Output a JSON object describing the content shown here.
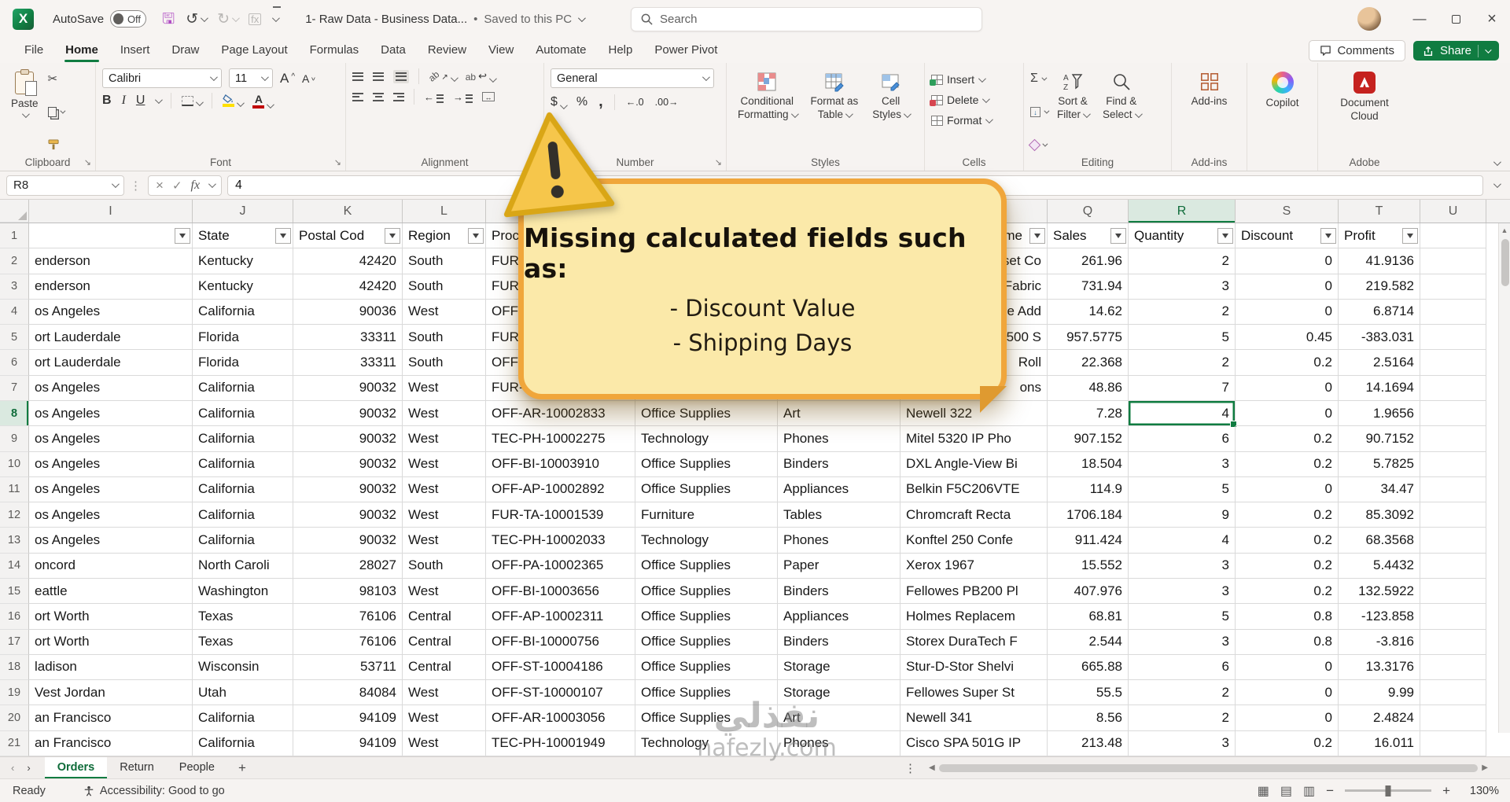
{
  "colors": {
    "accent_green": "#107C41",
    "callout_fill": "#FBE9A9",
    "callout_border": "#F0A63B",
    "share_green": "#107C41"
  },
  "titlebar": {
    "autosave_label": "AutoSave",
    "autosave_state": "Off",
    "doc_title": "1- Raw Data - Business Data...",
    "separator": "•",
    "doc_status": "Saved to this PC",
    "search_placeholder": "Search"
  },
  "ribbon": {
    "tabs": [
      "File",
      "Home",
      "Insert",
      "Draw",
      "Page Layout",
      "Formulas",
      "Data",
      "Review",
      "View",
      "Automate",
      "Help",
      "Power Pivot"
    ],
    "active_tab": "Home",
    "comments_label": "Comments",
    "share_label": "Share",
    "clipboard": {
      "paste": "Paste",
      "group": "Clipboard"
    },
    "font": {
      "name": "Calibri",
      "size": "11",
      "bold": "B",
      "italic": "I",
      "underline": "U",
      "grow": "A",
      "shrink": "A",
      "color_a": "A",
      "group": "Font"
    },
    "alignment": {
      "orient": "ab",
      "wrap": "ab",
      "group": "Alignment"
    },
    "number": {
      "format": "General",
      "currency": "$",
      "percent": "%",
      "comma": ",",
      "dec_inc": "←.0",
      "dec_dec": ".00→",
      "group": "Number"
    },
    "styles": {
      "cond1": "Conditional",
      "cond2": "Formatting",
      "fmt1": "Format as",
      "fmt2": "Table",
      "cs1": "Cell",
      "cs2": "Styles",
      "group": "Styles"
    },
    "cells": {
      "insert": "Insert",
      "delete": "Delete",
      "format": "Format",
      "group": "Cells"
    },
    "editing": {
      "sum": "Σ",
      "sort1": "Sort &",
      "sort2": "Filter",
      "find1": "Find &",
      "find2": "Select",
      "group": "Editing"
    },
    "addins": {
      "label": "Add-ins",
      "group": "Add-ins"
    },
    "copilot": {
      "label": "Copilot"
    },
    "adobe": {
      "label1": "Document",
      "label2": "Cloud",
      "group": "Adobe"
    }
  },
  "formula": {
    "name_box": "R8",
    "cancel": "×",
    "ok": "✓",
    "fx": "fx",
    "value": "4"
  },
  "callout": {
    "heading": "Missing calculated fields such as:",
    "items": [
      "- Discount Value",
      "- Shipping Days"
    ]
  },
  "grid": {
    "col_letters": [
      "I",
      "J",
      "K",
      "L",
      "M",
      "N",
      "O",
      "P",
      "Q",
      "R",
      "S",
      "T",
      "U"
    ],
    "selected_col": "R",
    "active_row": 8,
    "active_col": "r",
    "headers": {
      "I": "",
      "J": "State",
      "K": "Postal Cod",
      "L": "Region",
      "M": "Proc",
      "N": "",
      "O": "",
      "P": "me",
      "Q": "Sales",
      "R": "Quantity",
      "S": "Discount",
      "T": "Profit",
      "U": ""
    },
    "filter_cols": [
      "I",
      "J",
      "K",
      "L",
      "P",
      "Q",
      "R",
      "S",
      "T"
    ],
    "rows": [
      {
        "num": 2,
        "i": "enderson",
        "j": "Kentucky",
        "k": "42420",
        "l": "South",
        "m": "FUR-",
        "n": "",
        "o": "",
        "p": "set Co",
        "q": "261.96",
        "r": "2",
        "s": "0",
        "t": "41.9136"
      },
      {
        "num": 3,
        "i": "enderson",
        "j": "Kentucky",
        "k": "42420",
        "l": "South",
        "m": "FUR-",
        "n": "",
        "o": "",
        "p": "Fabric",
        "q": "731.94",
        "r": "3",
        "s": "0",
        "t": "219.582"
      },
      {
        "num": 4,
        "i": "os Angeles",
        "j": "California",
        "k": "90036",
        "l": "West",
        "m": "OFF-",
        "n": "",
        "o": "",
        "p": "e Add",
        "q": "14.62",
        "r": "2",
        "s": "0",
        "t": "6.8714"
      },
      {
        "num": 5,
        "i": "ort Lauderdale",
        "j": "Florida",
        "k": "33311",
        "l": "South",
        "m": "FUR-",
        "n": "",
        "o": "",
        "p": "500 S",
        "q": "957.5775",
        "r": "5",
        "s": "0.45",
        "t": "-383.031"
      },
      {
        "num": 6,
        "i": "ort Lauderdale",
        "j": "Florida",
        "k": "33311",
        "l": "South",
        "m": "OFF-",
        "n": "",
        "o": "",
        "p": "Roll",
        "q": "22.368",
        "r": "2",
        "s": "0.2",
        "t": "2.5164"
      },
      {
        "num": 7,
        "i": "os Angeles",
        "j": "California",
        "k": "90032",
        "l": "West",
        "m": "FUR-Fu",
        "n": "",
        "o": "",
        "p": "ons",
        "q": "48.86",
        "r": "7",
        "s": "0",
        "t": "14.1694"
      },
      {
        "num": 8,
        "i": "os Angeles",
        "j": "California",
        "k": "90032",
        "l": "West",
        "m": "OFF-AR-10002833",
        "n": "Office Supplies",
        "o": "Art",
        "p": "Newell 322",
        "q": "7.28",
        "r": "4",
        "s": "0",
        "t": "1.9656"
      },
      {
        "num": 9,
        "i": "os Angeles",
        "j": "California",
        "k": "90032",
        "l": "West",
        "m": "TEC-PH-10002275",
        "n": "Technology",
        "o": "Phones",
        "p": "Mitel 5320 IP Pho",
        "q": "907.152",
        "r": "6",
        "s": "0.2",
        "t": "90.7152"
      },
      {
        "num": 10,
        "i": "os Angeles",
        "j": "California",
        "k": "90032",
        "l": "West",
        "m": "OFF-BI-10003910",
        "n": "Office Supplies",
        "o": "Binders",
        "p": "DXL Angle-View Bi",
        "q": "18.504",
        "r": "3",
        "s": "0.2",
        "t": "5.7825"
      },
      {
        "num": 11,
        "i": "os Angeles",
        "j": "California",
        "k": "90032",
        "l": "West",
        "m": "OFF-AP-10002892",
        "n": "Office Supplies",
        "o": "Appliances",
        "p": "Belkin F5C206VTE",
        "q": "114.9",
        "r": "5",
        "s": "0",
        "t": "34.47"
      },
      {
        "num": 12,
        "i": "os Angeles",
        "j": "California",
        "k": "90032",
        "l": "West",
        "m": "FUR-TA-10001539",
        "n": "Furniture",
        "o": "Tables",
        "p": "Chromcraft Recta",
        "q": "1706.184",
        "r": "9",
        "s": "0.2",
        "t": "85.3092"
      },
      {
        "num": 13,
        "i": "os Angeles",
        "j": "California",
        "k": "90032",
        "l": "West",
        "m": "TEC-PH-10002033",
        "n": "Technology",
        "o": "Phones",
        "p": "Konftel 250 Confe",
        "q": "911.424",
        "r": "4",
        "s": "0.2",
        "t": "68.3568"
      },
      {
        "num": 14,
        "i": "oncord",
        "j": "North Caroli",
        "k": "28027",
        "l": "South",
        "m": "OFF-PA-10002365",
        "n": "Office Supplies",
        "o": "Paper",
        "p": "Xerox 1967",
        "q": "15.552",
        "r": "3",
        "s": "0.2",
        "t": "5.4432"
      },
      {
        "num": 15,
        "i": "eattle",
        "j": "Washington",
        "k": "98103",
        "l": "West",
        "m": "OFF-BI-10003656",
        "n": "Office Supplies",
        "o": "Binders",
        "p": "Fellowes PB200 Pl",
        "q": "407.976",
        "r": "3",
        "s": "0.2",
        "t": "132.5922"
      },
      {
        "num": 16,
        "i": "ort Worth",
        "j": "Texas",
        "k": "76106",
        "l": "Central",
        "m": "OFF-AP-10002311",
        "n": "Office Supplies",
        "o": "Appliances",
        "p": "Holmes Replacem",
        "q": "68.81",
        "r": "5",
        "s": "0.8",
        "t": "-123.858"
      },
      {
        "num": 17,
        "i": "ort Worth",
        "j": "Texas",
        "k": "76106",
        "l": "Central",
        "m": "OFF-BI-10000756",
        "n": "Office Supplies",
        "o": "Binders",
        "p": "Storex DuraTech F",
        "q": "2.544",
        "r": "3",
        "s": "0.8",
        "t": "-3.816"
      },
      {
        "num": 18,
        "i": "ladison",
        "j": "Wisconsin",
        "k": "53711",
        "l": "Central",
        "m": "OFF-ST-10004186",
        "n": "Office Supplies",
        "o": "Storage",
        "p": "Stur-D-Stor Shelvi",
        "q": "665.88",
        "r": "6",
        "s": "0",
        "t": "13.3176"
      },
      {
        "num": 19,
        "i": "Vest Jordan",
        "j": "Utah",
        "k": "84084",
        "l": "West",
        "m": "OFF-ST-10000107",
        "n": "Office Supplies",
        "o": "Storage",
        "p": "Fellowes Super St",
        "q": "55.5",
        "r": "2",
        "s": "0",
        "t": "9.99"
      },
      {
        "num": 20,
        "i": "an Francisco",
        "j": "California",
        "k": "94109",
        "l": "West",
        "m": "OFF-AR-10003056",
        "n": "Office Supplies",
        "o": "Art",
        "p": "Newell 341",
        "q": "8.56",
        "r": "2",
        "s": "0",
        "t": "2.4824"
      },
      {
        "num": 21,
        "i": "an Francisco",
        "j": "California",
        "k": "94109",
        "l": "West",
        "m": "TEC-PH-10001949",
        "n": "Technology",
        "o": "Phones",
        "p": "Cisco SPA 501G IP",
        "q": "213.48",
        "r": "3",
        "s": "0.2",
        "t": "16.011"
      }
    ]
  },
  "sheets": {
    "tabs": [
      "Orders",
      "Return",
      "People"
    ],
    "active": "Orders",
    "add": "+"
  },
  "statusbar": {
    "ready": "Ready",
    "accessibility": "Accessibility: Good to go",
    "zoom": "130%"
  },
  "watermark": {
    "line1": "نفذلي",
    "line2": "nafezly.com"
  }
}
